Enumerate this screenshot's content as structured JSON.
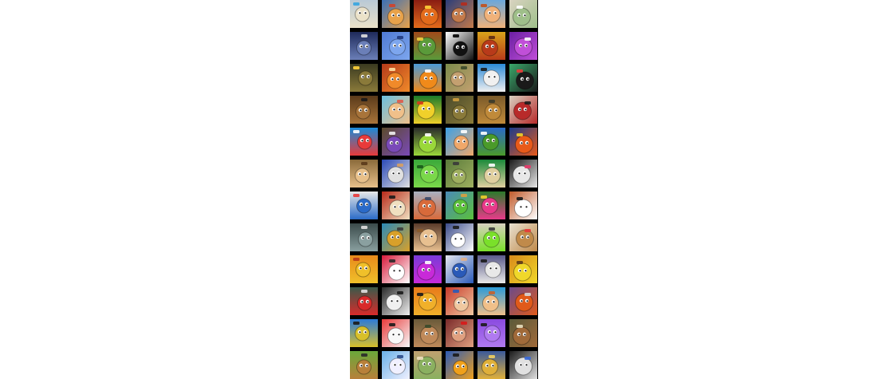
{
  "grid": {
    "title": "",
    "games": [
      {
        "icon": "room-door-icon",
        "c1": "#b9c9d6",
        "c2": "#ebe2c9",
        "accent": "#36a5e0"
      },
      {
        "icon": "orange-creature-icon",
        "c1": "#3a6fb6",
        "c2": "#e8a24a",
        "accent": "#d2432a"
      },
      {
        "icon": "fire-monster-icon",
        "c1": "#8a1d12",
        "c2": "#e36b1b",
        "accent": "#ffd23a"
      },
      {
        "icon": "pirate-captain-icon",
        "c1": "#2a3d7a",
        "c2": "#c47a4a",
        "accent": "#b52b1c"
      },
      {
        "icon": "redhead-boy-icon",
        "c1": "#6aa7db",
        "c2": "#f0b27a",
        "accent": "#c2501c"
      },
      {
        "icon": "kitchen-room-icon",
        "c1": "#d9d3c1",
        "c2": "#9fbf8a",
        "accent": "#ffffff"
      },
      {
        "icon": "robot-mech-icon",
        "c1": "#1e2a5a",
        "c2": "#6b7fb8",
        "accent": "#e0e0e0"
      },
      {
        "icon": "blue-blob-icon",
        "c1": "#4f7ad3",
        "c2": "#7da6ee",
        "accent": "#203a80"
      },
      {
        "icon": "city-skyline-icon",
        "c1": "#a04a1a",
        "c2": "#5a9a3a",
        "accent": "#f0d040"
      },
      {
        "icon": "at-logo-icon",
        "c1": "#ffffff",
        "c2": "#111111",
        "accent": "#000000"
      },
      {
        "icon": "burning-man-icon",
        "c1": "#d8a21a",
        "c2": "#b83a1a",
        "accent": "#5a2a14"
      },
      {
        "icon": "unicorn-icon",
        "c1": "#6b1fa2",
        "c2": "#c04fd8",
        "accent": "#ffffff"
      },
      {
        "icon": "monster-truck-icon",
        "c1": "#3a3a20",
        "c2": "#8a7a3a",
        "accent": "#ffd23a"
      },
      {
        "icon": "orange-cat-icon",
        "c1": "#b43a1a",
        "c2": "#f08a2a",
        "accent": "#ffe0a0"
      },
      {
        "icon": "one-eye-ball-icon",
        "c1": "#4a9ad8",
        "c2": "#f08a1a",
        "accent": "#ffffff"
      },
      {
        "icon": "soldier-icon",
        "c1": "#7a8a4a",
        "c2": "#c4a070",
        "accent": "#3a4a2a"
      },
      {
        "icon": "pirate-ghost-icon",
        "c1": "#2a8ad8",
        "c2": "#f0f0f0",
        "accent": "#1a1a1a"
      },
      {
        "icon": "grinning-ball-icon",
        "c1": "#3aa86a",
        "c2": "#1a1a1a",
        "accent": "#e83a3a"
      },
      {
        "icon": "brown-bear-icon",
        "c1": "#5a3a1a",
        "c2": "#a8743a",
        "accent": "#1a1a1a"
      },
      {
        "icon": "hiker-girl-icon",
        "c1": "#6ac0e0",
        "c2": "#f0c08a",
        "accent": "#e05a4a"
      },
      {
        "icon": "yellow-bird-icon",
        "c1": "#1a7a2a",
        "c2": "#f0d02a",
        "accent": "#d83a1a"
      },
      {
        "icon": "army-jeep-icon",
        "c1": "#4a4a2a",
        "c2": "#8a7a3a",
        "accent": "#d0a040"
      },
      {
        "icon": "tank-icon",
        "c1": "#7a5a2a",
        "c2": "#c08a3a",
        "accent": "#3a3a2a"
      },
      {
        "icon": "masked-bandit-icon",
        "c1": "#d8d0c0",
        "c2": "#b82a2a",
        "accent": "#1a1a1a"
      },
      {
        "icon": "angry-red-block-icon",
        "c1": "#1a8ad8",
        "c2": "#e83a3a",
        "accent": "#ffffff"
      },
      {
        "icon": "purple-blob-icon",
        "c1": "#5a4a2a",
        "c2": "#7a4ab8",
        "accent": "#f0f0f0"
      },
      {
        "icon": "green-tower-icon",
        "c1": "#2a2a2a",
        "c2": "#9ad83a",
        "accent": "#ffffff"
      },
      {
        "icon": "number-balls-icon",
        "c1": "#3aa0e8",
        "c2": "#f0a86a",
        "accent": "#ffffff"
      },
      {
        "icon": "blue-cube-icon",
        "c1": "#2a6ac8",
        "c2": "#4a9a2a",
        "accent": "#ffffff"
      },
      {
        "icon": "swirl-icon",
        "c1": "#1a3a8a",
        "c2": "#e85a1a",
        "accent": "#f0d02a"
      },
      {
        "icon": "bearded-man-icon",
        "c1": "#8a6a3a",
        "c2": "#e8c08a",
        "accent": "#5a3a1a"
      },
      {
        "icon": "delivery-man-icon",
        "c1": "#2a4ab8",
        "c2": "#e0e0e0",
        "accent": "#d8a060"
      },
      {
        "icon": "green-slime-icon",
        "c1": "#3aa83a",
        "c2": "#7ad84a",
        "accent": "#1a5a1a"
      },
      {
        "icon": "battle-tank-icon",
        "c1": "#5a7a3a",
        "c2": "#a0b060",
        "accent": "#3a3a3a"
      },
      {
        "icon": "green-maze-icon",
        "c1": "#1a8a3a",
        "c2": "#e0d0a0",
        "accent": "#ffffff"
      },
      {
        "icon": "dark-eyeball-icon",
        "c1": "#1a1a1a",
        "c2": "#e8e8e8",
        "accent": "#e83a6a"
      },
      {
        "icon": "superhero-kid-icon",
        "c1": "#e8e8e8",
        "c2": "#2a6ac8",
        "accent": "#e83a3a"
      },
      {
        "icon": "sushi-chef-icon",
        "c1": "#b82a1a",
        "c2": "#f0e0c0",
        "accent": "#1a1a1a"
      },
      {
        "icon": "round-clock-icon",
        "c1": "#a8b0c0",
        "c2": "#d86a3a",
        "accent": "#3a4a6a"
      },
      {
        "icon": "green-dragon-icon",
        "c1": "#4a8ab8",
        "c2": "#5ac03a",
        "accent": "#d8a040"
      },
      {
        "icon": "pink-flower-icon",
        "c1": "#2a7a2a",
        "c2": "#e83a8a",
        "accent": "#f0d02a"
      },
      {
        "icon": "zebra-icon",
        "c1": "#c05a2a",
        "c2": "#ffffff",
        "accent": "#1a1a1a"
      },
      {
        "icon": "race-car-icon",
        "c1": "#3a4a4a",
        "c2": "#8aa0a0",
        "accent": "#e0e0e0"
      },
      {
        "icon": "dump-truck-icon",
        "c1": "#2a8ab8",
        "c2": "#d8a02a",
        "accent": "#3a3a3a"
      },
      {
        "icon": "explorer-boy-icon",
        "c1": "#5a3a2a",
        "c2": "#e8c090",
        "accent": "#8a5a2a"
      },
      {
        "icon": "googly-eyes-icon",
        "c1": "#3a4a8a",
        "c2": "#ffffff",
        "accent": "#1a1a1a"
      },
      {
        "icon": "green-bomb-icon",
        "c1": "#d8d0c0",
        "c2": "#7ae02a",
        "accent": "#3a3a3a"
      },
      {
        "icon": "cartoon-cow-icon",
        "c1": "#e8e0d0",
        "c2": "#c08a4a",
        "accent": "#e83a3a"
      },
      {
        "icon": "lion-face-icon",
        "c1": "#e88a1a",
        "c2": "#f0c02a",
        "accent": "#b83a1a"
      },
      {
        "icon": "red-devil-icon",
        "c1": "#d81a3a",
        "c2": "#ffffff",
        "accent": "#2a2a2a"
      },
      {
        "icon": "purple-cube-icon",
        "c1": "#7a3ad8",
        "c2": "#c82ad8",
        "accent": "#ffffff"
      },
      {
        "icon": "chef-boy-icon",
        "c1": "#e8e8f0",
        "c2": "#2a5ab8",
        "accent": "#e0b08a"
      },
      {
        "icon": "grumpy-owl-icon",
        "c1": "#5a5a8a",
        "c2": "#e8e8e8",
        "accent": "#1a1a1a"
      },
      {
        "icon": "yellow-smiley-icon",
        "c1": "#d88a1a",
        "c2": "#f0d82a",
        "accent": "#5a3a1a"
      },
      {
        "icon": "sports-car-icon",
        "c1": "#3a5a4a",
        "c2": "#d82a2a",
        "accent": "#e0e0e0"
      },
      {
        "icon": "panda-bear-icon",
        "c1": "#2a2a2a",
        "c2": "#f0f0f0",
        "accent": "#1a1a1a"
      },
      {
        "icon": "orange-face-icon",
        "c1": "#e87a1a",
        "c2": "#f0b02a",
        "accent": "#1a1a1a"
      },
      {
        "icon": "angry-grandpa-icon",
        "c1": "#c83a2a",
        "c2": "#f0c8a0",
        "accent": "#2a5ab8"
      },
      {
        "icon": "cartoon-guy-icon",
        "c1": "#2a9ad8",
        "c2": "#f0c08a",
        "accent": "#c8602a"
      },
      {
        "icon": "buggy-car-icon",
        "c1": "#6a4a8a",
        "c2": "#e05a1a",
        "accent": "#d8d8d8"
      },
      {
        "icon": "blue-monster-icon",
        "c1": "#2a7ad8",
        "c2": "#d8c02a",
        "accent": "#1a1a1a"
      },
      {
        "icon": "white-rabbit-icon",
        "c1": "#e83a3a",
        "c2": "#f8f8f8",
        "accent": "#1a1a1a"
      },
      {
        "icon": "commando-icon",
        "c1": "#6a5a3a",
        "c2": "#c08a5a",
        "accent": "#3a4a2a"
      },
      {
        "icon": "red-bandana-icon",
        "c1": "#7a2a2a",
        "c2": "#e0a080",
        "accent": "#d81a1a"
      },
      {
        "icon": "purple-square-icon",
        "c1": "#8a4ae0",
        "c2": "#b07af0",
        "accent": "#1a1a1a"
      },
      {
        "icon": "t-rex-icon",
        "c1": "#5a5a3a",
        "c2": "#a06a3a",
        "accent": "#e8e0c0"
      },
      {
        "icon": "hedgehog-icon",
        "c1": "#6aa83a",
        "c2": "#b8803a",
        "accent": "#2a2a2a"
      },
      {
        "icon": "white-kitten-icon",
        "c1": "#6ab0e8",
        "c2": "#f0f0ff",
        "accent": "#2a4a8a"
      },
      {
        "icon": "paper-road-icon",
        "c1": "#c0a070",
        "c2": "#8ab060",
        "accent": "#f0e0c0"
      },
      {
        "icon": "cool-block-icon",
        "c1": "#2a5ab8",
        "c2": "#f0a01a",
        "accent": "#1a1a1a"
      },
      {
        "icon": "money-bag-icon",
        "c1": "#3a5a9a",
        "c2": "#e0b03a",
        "accent": "#f0d060"
      },
      {
        "icon": "checkered-racer-icon",
        "c1": "#1a1a1a",
        "c2": "#e0e0e0",
        "accent": "#3a6ad8"
      }
    ]
  }
}
